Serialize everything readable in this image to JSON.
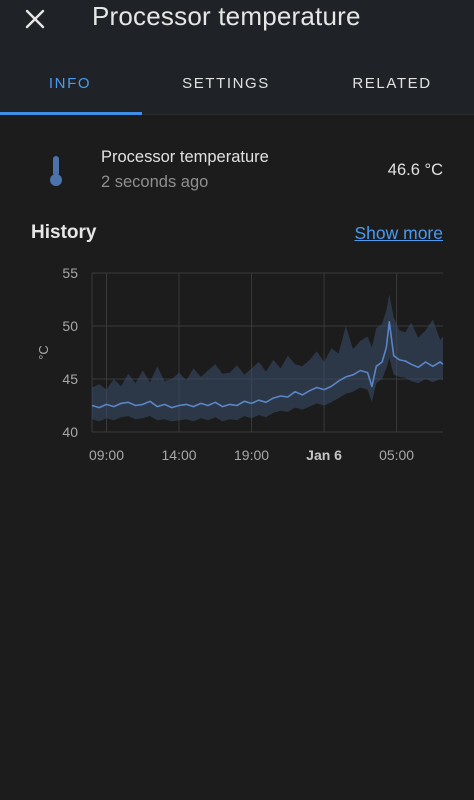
{
  "header": {
    "title": "Processor temperature",
    "close_icon": "close-icon"
  },
  "tabs": [
    {
      "label": "INFO",
      "active": true
    },
    {
      "label": "SETTINGS",
      "active": false
    },
    {
      "label": "RELATED",
      "active": false
    }
  ],
  "entity": {
    "name": "Processor temperature",
    "last_changed": "2 seconds ago",
    "state": "46.6 °C",
    "icon": "thermometer-icon"
  },
  "history": {
    "title": "History",
    "show_more": "Show more"
  },
  "colors": {
    "accent": "#4a9bf0",
    "series": "#5b86c6",
    "band": "#3b4e6e"
  },
  "chart_data": {
    "type": "line",
    "ylabel": "°C",
    "ylim": [
      40,
      55
    ],
    "yticks": [
      40,
      45,
      50,
      55
    ],
    "xticks": [
      {
        "label": "09:00",
        "hour": 9,
        "bold": false
      },
      {
        "label": "14:00",
        "hour": 14,
        "bold": false
      },
      {
        "label": "19:00",
        "hour": 19,
        "bold": false
      },
      {
        "label": "Jan 6",
        "hour": 24,
        "bold": true
      },
      {
        "label": "05:00",
        "hour": 29,
        "bold": false
      }
    ],
    "xlim_hours": [
      8.0,
      32.2
    ],
    "grid": true,
    "series": [
      {
        "x_hours": [
          8.0,
          8.5,
          9.0,
          9.5,
          10.0,
          10.5,
          11.0,
          11.5,
          12.0,
          12.5,
          13.0,
          13.5,
          14.0,
          14.5,
          15.0,
          15.5,
          16.0,
          16.5,
          17.0,
          17.5,
          18.0,
          18.5,
          19.0,
          19.5,
          20.0,
          20.5,
          21.0,
          21.5,
          22.0,
          22.5,
          23.0,
          23.5,
          24.0,
          24.5,
          25.0,
          25.5,
          26.0,
          26.5,
          27.0,
          27.3,
          27.6,
          28.0,
          28.3,
          28.5,
          28.8,
          29.2,
          29.6,
          30.0,
          30.5,
          31.0,
          31.5,
          32.0,
          32.2
        ],
        "values": [
          42.5,
          42.3,
          42.6,
          42.4,
          42.7,
          42.8,
          42.5,
          42.6,
          42.9,
          42.4,
          42.6,
          42.3,
          42.5,
          42.6,
          42.4,
          42.7,
          42.5,
          42.8,
          42.4,
          42.6,
          42.5,
          42.9,
          42.7,
          43.0,
          42.8,
          43.2,
          43.4,
          43.3,
          43.8,
          43.5,
          43.9,
          44.2,
          44.0,
          44.3,
          44.8,
          45.2,
          45.4,
          45.8,
          45.6,
          44.3,
          46.2,
          46.6,
          48.0,
          50.4,
          47.2,
          46.8,
          46.7,
          46.4,
          46.1,
          46.6,
          46.2,
          46.6,
          46.4
        ],
        "band_min": [
          41.2,
          41.0,
          41.3,
          41.1,
          41.4,
          41.5,
          41.2,
          41.3,
          41.5,
          41.1,
          41.2,
          41.0,
          41.1,
          41.2,
          41.0,
          41.3,
          41.1,
          41.4,
          41.0,
          41.2,
          41.1,
          41.5,
          41.3,
          41.6,
          41.4,
          41.8,
          42.0,
          41.9,
          42.3,
          42.1,
          42.4,
          42.7,
          42.5,
          42.8,
          43.2,
          43.6,
          43.8,
          44.2,
          44.0,
          42.8,
          44.6,
          45.0,
          46.0,
          47.0,
          45.4,
          45.2,
          45.1,
          44.8,
          44.6,
          45.0,
          44.7,
          45.0,
          44.9
        ],
        "band_max": [
          44.2,
          44.5,
          44.0,
          45.0,
          44.3,
          45.5,
          44.6,
          45.8,
          44.7,
          46.2,
          44.8,
          45.0,
          45.6,
          44.9,
          46.0,
          45.2,
          45.8,
          46.4,
          45.5,
          45.6,
          46.3,
          45.4,
          46.0,
          46.6,
          45.7,
          46.8,
          46.0,
          47.2,
          46.4,
          46.2,
          46.8,
          47.6,
          46.6,
          47.9,
          47.4,
          50.0,
          47.8,
          48.6,
          49.0,
          48.0,
          49.8,
          50.2,
          51.5,
          53.0,
          50.8,
          49.6,
          49.4,
          50.3,
          48.9,
          49.6,
          50.6,
          48.7,
          49.0
        ]
      }
    ]
  }
}
